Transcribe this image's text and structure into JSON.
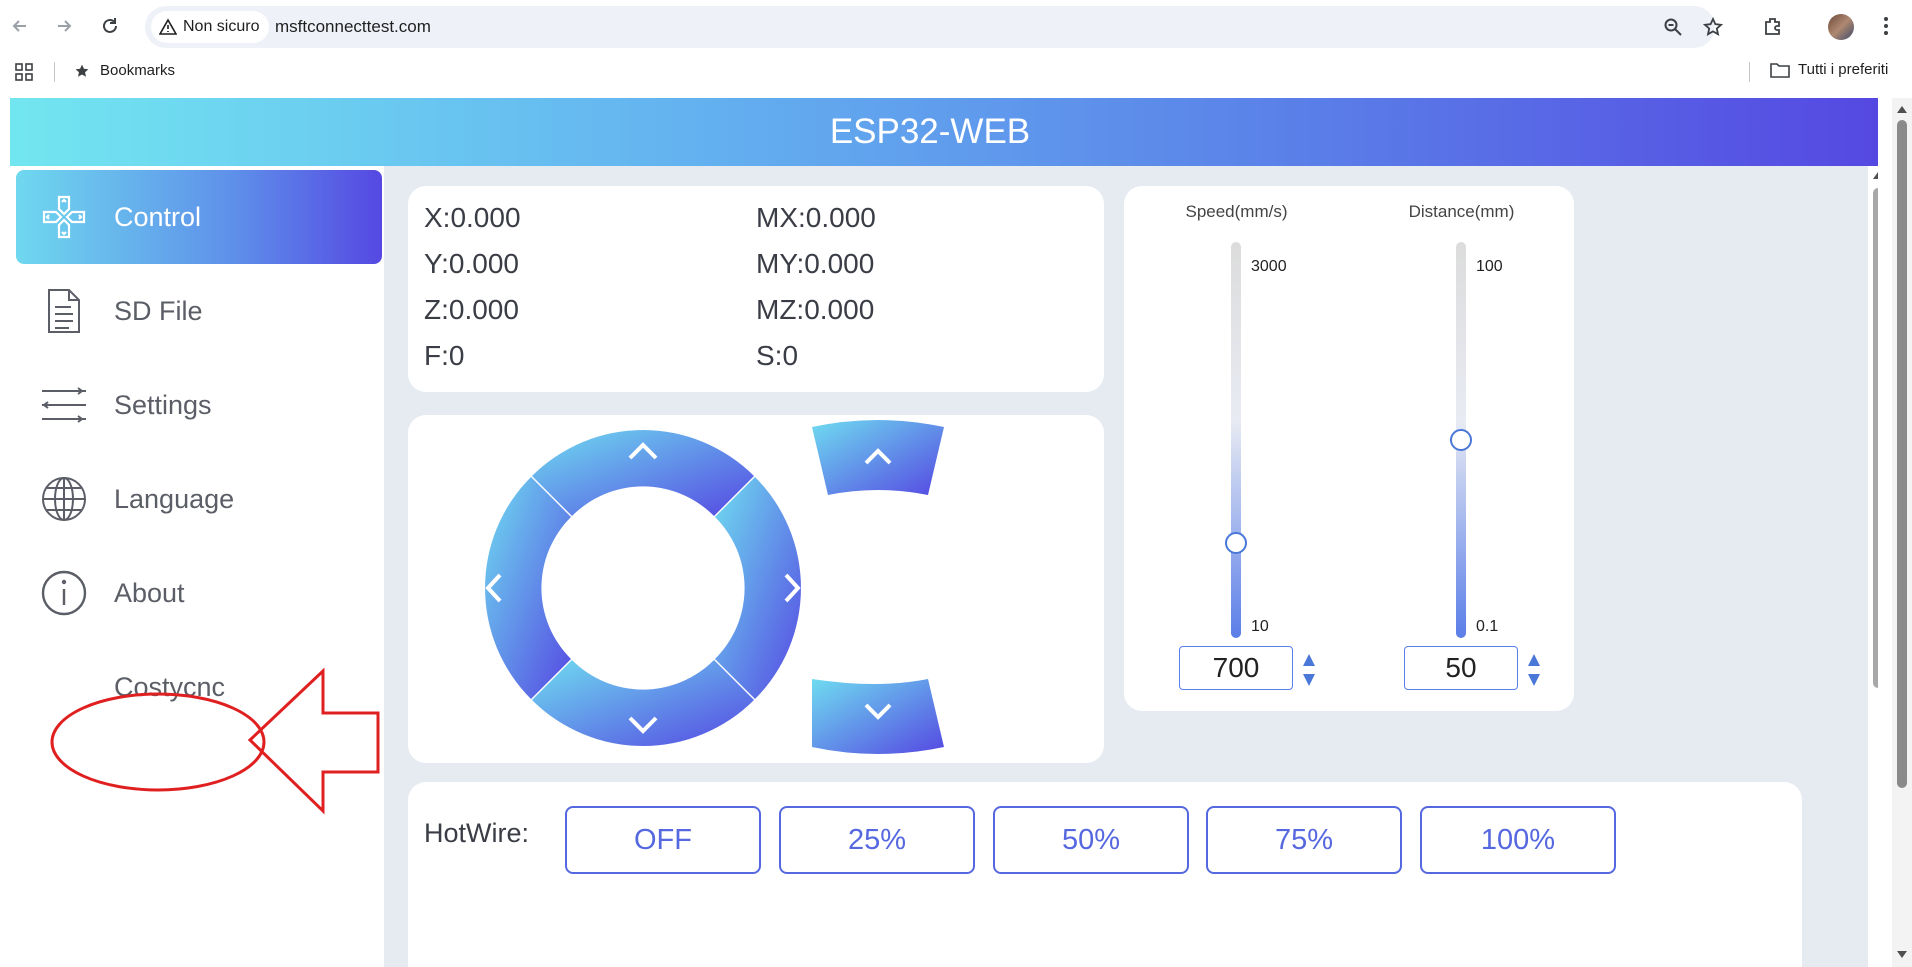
{
  "browser": {
    "security_label": "Non sicuro",
    "url": "msftconnecttest.com",
    "bookmarks_label": "Bookmarks",
    "all_bookmarks_label": "Tutti i preferiti"
  },
  "app": {
    "title": "ESP32-WEB"
  },
  "sidebar": {
    "items": [
      {
        "label": "Control",
        "icon": "dpad-icon",
        "active": true
      },
      {
        "label": "SD File",
        "icon": "document-icon"
      },
      {
        "label": "Settings",
        "icon": "sliders-icon"
      },
      {
        "label": "Language",
        "icon": "globe-icon"
      },
      {
        "label": "About",
        "icon": "info-icon"
      },
      {
        "label": "Costycnc"
      }
    ]
  },
  "position": {
    "x": "X:0.000",
    "y": "Y:0.000",
    "z": "Z:0.000",
    "f": "F:0",
    "mx": "MX:0.000",
    "my": "MY:0.000",
    "mz": "MZ:0.000",
    "s": "S:0"
  },
  "speed": {
    "title": "Speed(mm/s)",
    "max_label": "3000",
    "min_label": "10",
    "value": "700",
    "level": 0.23
  },
  "distance": {
    "title": "Distance(mm)",
    "max_label": "100",
    "min_label": "0.1",
    "value": "50",
    "level": 0.5
  },
  "hotwire": {
    "label": "HotWire:",
    "buttons": [
      "OFF",
      "25%",
      "50%",
      "75%",
      "100%"
    ]
  },
  "colors": {
    "accent": "#5668e0",
    "gradient_start": "#72e6f0",
    "gradient_end": "#5548e2",
    "annotation": "#e02020"
  }
}
